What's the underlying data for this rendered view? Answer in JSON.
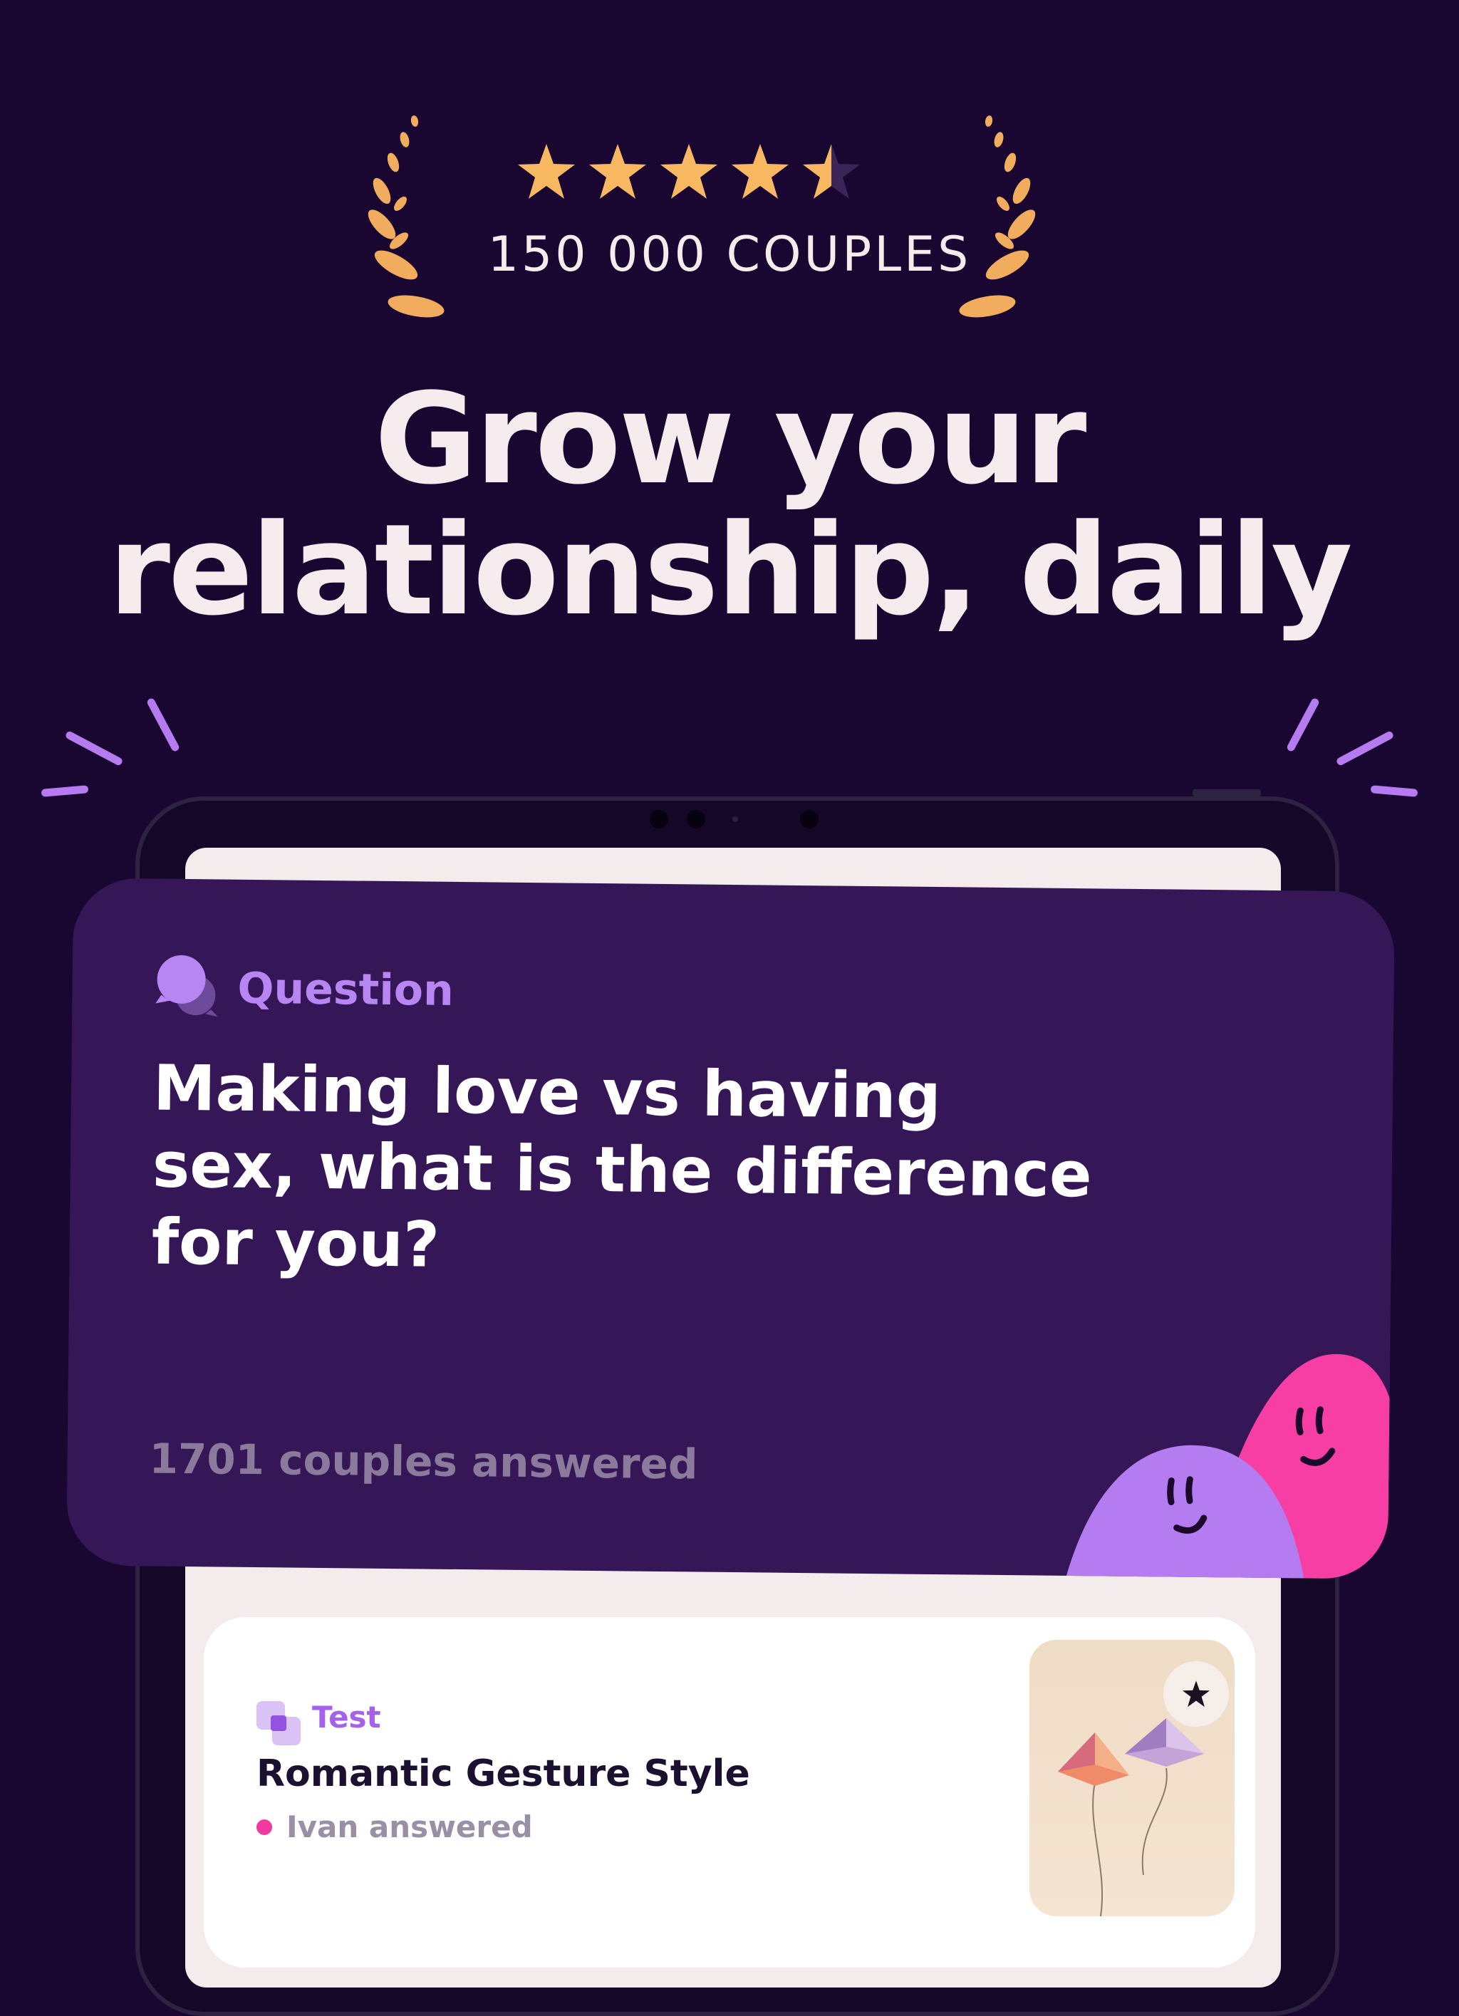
{
  "rating": {
    "stars": 4.5,
    "couples_label": "150 000 COUPLES"
  },
  "headline": {
    "line1": "Grow your",
    "line2": "relationship, daily"
  },
  "question_card": {
    "label": "Question",
    "text": "Making love vs having sex, what is the difference for you?",
    "answered_count": "1701 couples answered"
  },
  "test_card": {
    "label": "Test",
    "title": "Romantic Gesture Style",
    "status": "Ivan answered"
  },
  "colors": {
    "background": "#190731",
    "card": "#351758",
    "accent_purple": "#b57cf2",
    "accent_pink": "#f63ea4",
    "star": "#f7b861"
  },
  "icons": [
    "laurel-left-icon",
    "laurel-right-icon",
    "star-icon",
    "chat-bubbles-icon",
    "test-square-icon",
    "bookmark-star-icon"
  ]
}
